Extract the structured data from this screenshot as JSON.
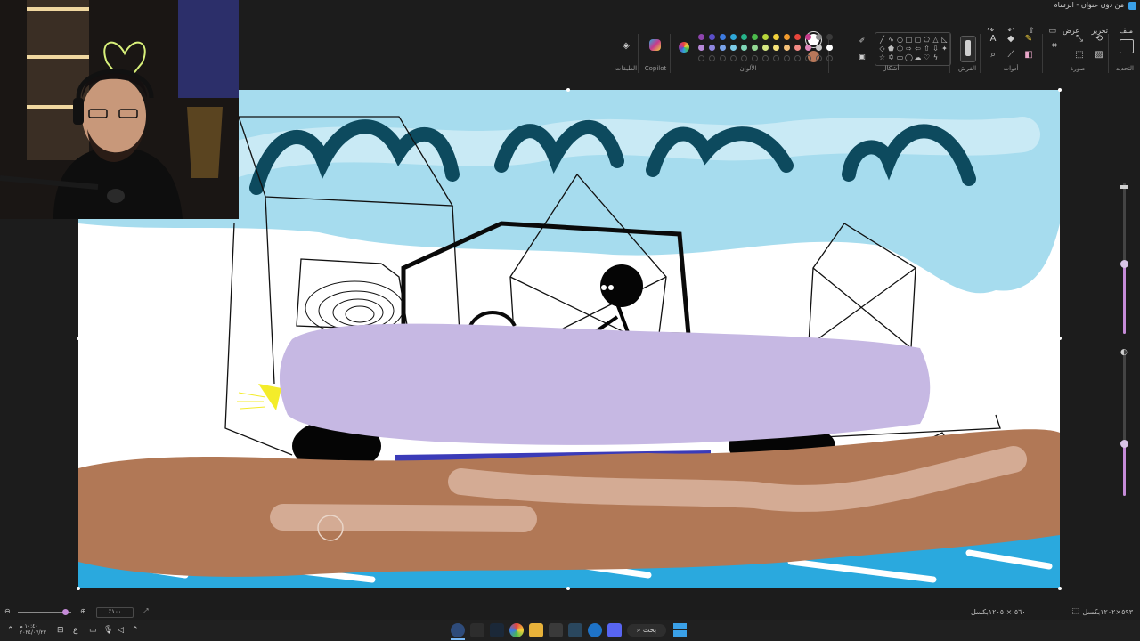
{
  "window": {
    "title": "من دون عنوان - الرسام"
  },
  "menu": {
    "file": "ملف",
    "edit": "تحرير",
    "view": "عرض"
  },
  "ribbon": {
    "groups": {
      "select": "التحديد",
      "image": "صورة",
      "tools": "أدوات",
      "brushes": "الفرش",
      "shapes": "أشكال",
      "colors": "الألوان",
      "copilot": "Copilot",
      "layers": "الطبقات"
    },
    "colors": [
      "#8e44ad",
      "#5b4fc9",
      "#3d7be0",
      "#2fa7d8",
      "#26b38a",
      "#4cbb4c",
      "#b7d63a",
      "#f2d03b",
      "#f29b2e",
      "#e8453c",
      "#c73a8c",
      "#8a8a8a",
      "#3a3a3a",
      "#ffffff"
    ],
    "colors_row2": [
      "#b788d8",
      "#8f86e0",
      "#7aa3ea",
      "#7ccbe8",
      "#7fd6b8",
      "#93d793",
      "#d5e682",
      "#f6e27a",
      "#f6c27a",
      "#f18a85",
      "#e088bd",
      "#c8c8c8",
      "#ffffff"
    ],
    "primary_color": "#ffffff",
    "secondary_color": "#b8785a"
  },
  "status": {
    "canvas_size": "٥٩٣‬×‬١٢٠٢بكسل",
    "selection_size": "٥٦٠ × ١٢٠٥بكسل",
    "zoom": "٪١٠٠"
  },
  "taskbar": {
    "search_label": "بحث",
    "time": "١٠:٤٠ م",
    "date": "٢٠٢٤/٠٧/٢٣",
    "lang": "ع"
  }
}
